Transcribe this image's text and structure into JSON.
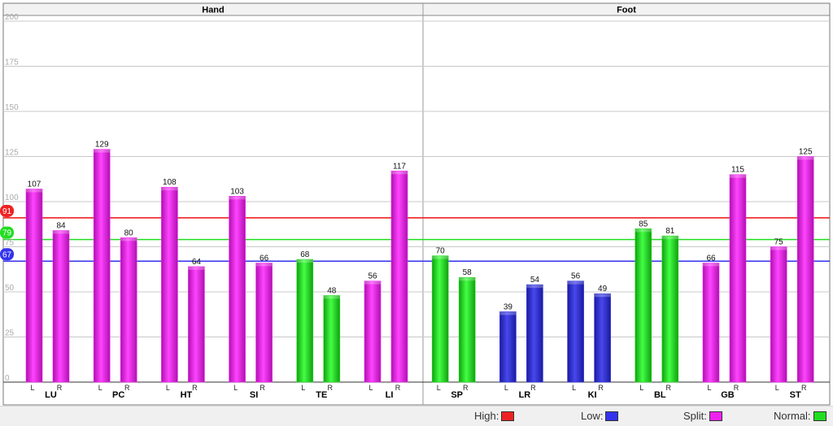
{
  "chart_data": {
    "type": "bar",
    "panels": [
      "Hand",
      "Foot"
    ],
    "ylim": [
      0,
      200
    ],
    "yticks": [
      0,
      25,
      50,
      75,
      100,
      125,
      150,
      175,
      200
    ],
    "side_labels": [
      "L",
      "R"
    ],
    "groups": [
      {
        "panel": "Hand",
        "name": "LU",
        "L": 107,
        "R": 84,
        "Lcolor": "split",
        "Rcolor": "split"
      },
      {
        "panel": "Hand",
        "name": "PC",
        "L": 129,
        "R": 80,
        "Lcolor": "split",
        "Rcolor": "split"
      },
      {
        "panel": "Hand",
        "name": "HT",
        "L": 108,
        "R": 64,
        "Lcolor": "split",
        "Rcolor": "split"
      },
      {
        "panel": "Hand",
        "name": "SI",
        "L": 103,
        "R": 66,
        "Lcolor": "split",
        "Rcolor": "split"
      },
      {
        "panel": "Hand",
        "name": "TE",
        "L": 68,
        "R": 48,
        "Lcolor": "normal",
        "Rcolor": "normal"
      },
      {
        "panel": "Hand",
        "name": "LI",
        "L": 56,
        "R": 117,
        "Lcolor": "split",
        "Rcolor": "split"
      },
      {
        "panel": "Foot",
        "name": "SP",
        "L": 70,
        "R": 58,
        "Lcolor": "normal",
        "Rcolor": "normal"
      },
      {
        "panel": "Foot",
        "name": "LR",
        "L": 39,
        "R": 54,
        "Lcolor": "low",
        "Rcolor": "low"
      },
      {
        "panel": "Foot",
        "name": "KI",
        "L": 56,
        "R": 49,
        "Lcolor": "low",
        "Rcolor": "low"
      },
      {
        "panel": "Foot",
        "name": "BL",
        "L": 85,
        "R": 81,
        "Lcolor": "normal",
        "Rcolor": "normal"
      },
      {
        "panel": "Foot",
        "name": "GB",
        "L": 66,
        "R": 115,
        "Lcolor": "split",
        "Rcolor": "split"
      },
      {
        "panel": "Foot",
        "name": "ST",
        "L": 75,
        "R": 125,
        "Lcolor": "split",
        "Rcolor": "split"
      }
    ],
    "reference_lines": [
      {
        "label": "91",
        "value": 91,
        "color": "#ee2222"
      },
      {
        "label": "79",
        "value": 79,
        "color": "#22dd22"
      },
      {
        "label": "67",
        "value": 67,
        "color": "#3333ee"
      }
    ],
    "colors": {
      "split": "#ee22ee",
      "normal": "#22dd22",
      "low": "#3333dd",
      "high": "#ee2222"
    },
    "legend": [
      {
        "label": "High:",
        "color": "#ee2222"
      },
      {
        "label": "Low:",
        "color": "#3333ee"
      },
      {
        "label": "Split:",
        "color": "#ee22ee"
      },
      {
        "label": "Normal:",
        "color": "#22dd22"
      }
    ]
  }
}
